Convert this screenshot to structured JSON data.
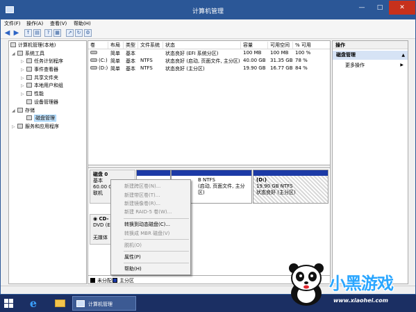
{
  "window": {
    "title": "计算机管理"
  },
  "menu": [
    "文件(F)",
    "操作(A)",
    "查看(V)",
    "帮助(H)"
  ],
  "toolbar_icons": [
    "back-arrow-icon",
    "forward-arrow-icon",
    "up-folder-icon",
    "show-hide-tree-icon",
    "help-icon",
    "properties-icon",
    "export-icon",
    "refresh-icon",
    "settings-icon"
  ],
  "tree": {
    "root": "计算机管理(本地)",
    "items": [
      {
        "label": "系统工具",
        "level": 1
      },
      {
        "label": "任务计划程序",
        "level": 2
      },
      {
        "label": "事件查看器",
        "level": 2
      },
      {
        "label": "共享文件夹",
        "level": 2
      },
      {
        "label": "本地用户和组",
        "level": 2
      },
      {
        "label": "性能",
        "level": 2
      },
      {
        "label": "设备管理器",
        "level": 2
      },
      {
        "label": "存储",
        "level": 1
      },
      {
        "label": "磁盘管理",
        "level": 2
      },
      {
        "label": "服务和应用程序",
        "level": 1
      }
    ]
  },
  "volumes": {
    "headers": [
      "卷",
      "布局",
      "类型",
      "文件系统",
      "状态",
      "容量",
      "可用空间",
      "% 可用"
    ],
    "rows": [
      [
        "",
        "简单",
        "基本",
        "",
        "状态良好 (EFI 系统分区)",
        "100 MB",
        "100 MB",
        "100 %"
      ],
      [
        "(C:)",
        "简单",
        "基本",
        "NTFS",
        "状态良好 (启动, 页面文件, 主分区)",
        "40.00 GB",
        "31.35 GB",
        "78 %"
      ],
      [
        "(D:)",
        "简单",
        "基本",
        "NTFS",
        "状态良好 (主分区)",
        "19.90 GB",
        "16.77 GB",
        "84 %"
      ]
    ]
  },
  "disk0": {
    "name": "磁盘 0",
    "type": "基本",
    "size": "60.00 G",
    "status": "联机",
    "c_part": {
      "line1": "B NTFS",
      "line2": "(启动, 页面文件, 主分区)"
    },
    "d_part": {
      "name": "(D:)",
      "size": "19.90 GB NTFS",
      "status": "状态良好 (主分区)"
    }
  },
  "cd0": {
    "name": "CD-",
    "line2": "DVD (E:",
    "line3": "无媒体"
  },
  "legend": {
    "unallocated": "未分配",
    "primary": "主分区"
  },
  "context_menu": [
    {
      "label": "新建跨区卷(N)...",
      "enabled": false
    },
    {
      "label": "新建带区卷(T)...",
      "enabled": false
    },
    {
      "label": "新建镜像卷(R)...",
      "enabled": false
    },
    {
      "label": "新建 RAID-5 卷(W)...",
      "enabled": false
    },
    {
      "label": "转换到动态磁盘(C)...",
      "enabled": true
    },
    {
      "label": "转换成 MBR 磁盘(V)",
      "enabled": false
    },
    {
      "label": "脱机(O)",
      "enabled": false
    },
    {
      "label": "属性(P)",
      "enabled": true
    },
    {
      "label": "帮助(H)",
      "enabled": true
    }
  ],
  "actions": {
    "header": "操作",
    "section": "磁盘管理",
    "more": "更多操作"
  },
  "taskbar": {
    "app_title": "计算机管理"
  },
  "watermark": {
    "logo": "小黑游戏",
    "url": "www.xiaohei.com"
  },
  "colors": {
    "titlebar": "#2b5797",
    "primary_partition": "#1c3aa6",
    "taskbar": "#1b2f63",
    "close": "#c7311c"
  }
}
